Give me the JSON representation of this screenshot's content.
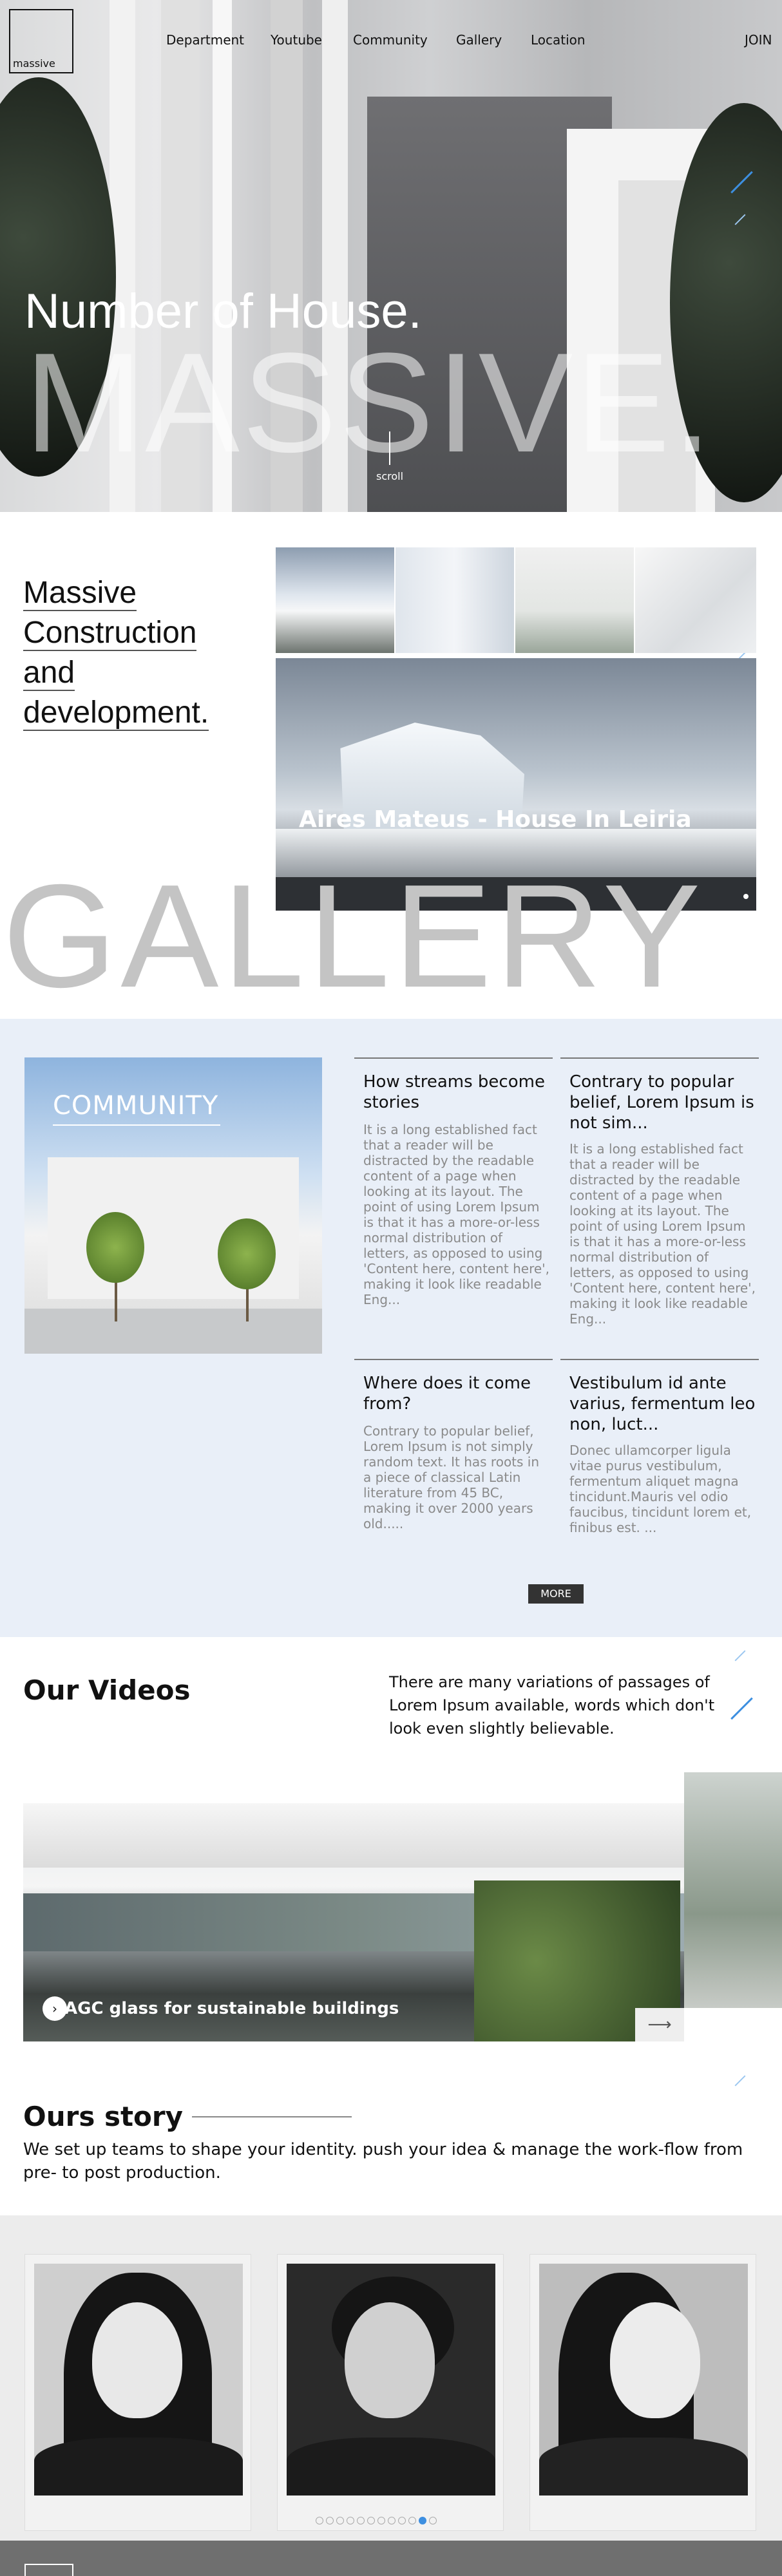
{
  "header": {
    "logo_text": "massive",
    "nav": [
      "Department",
      "Youtube",
      "Community",
      "Gallery",
      "Location"
    ],
    "join_label": "JOIN"
  },
  "hero": {
    "title": "Number of House.",
    "big_text": "MASSIVE.",
    "scroll_label": "scroll"
  },
  "intro": {
    "title_lines": [
      "Massive",
      "Construction",
      "and",
      "development."
    ],
    "feature_caption": "Aires Mateus - House In Leiria",
    "gallery_word": "GALLERY"
  },
  "community": {
    "image_label": "COMMUNITY",
    "cards": [
      {
        "title": "How streams become stories",
        "text": "It is a long established fact that a reader will be distracted by the readable content of a page when looking at its layout. The point of using Lorem Ipsum is that it has a more-or-less normal distribution of letters, as opposed to using 'Content here, content here', making it look like readable Eng..."
      },
      {
        "title": "Contrary to popular belief, Lorem Ipsum is not sim...",
        "text": "It is a long established fact that a reader will be distracted by the readable content of a page when looking at its layout. The point of using Lorem Ipsum is that it has a more-or-less normal distribution of letters, as opposed to using 'Content here, content here', making it look like readable Eng..."
      },
      {
        "title": "Where does it come from?",
        "text": "Contrary to popular belief, Lorem Ipsum is not simply random text. It has roots in a piece of classical Latin literature from 45 BC, making it over 2000 years old....."
      },
      {
        "title": "Vestibulum id ante varius, fermentum leo non, luct...",
        "text": "Donec ullamcorper ligula vitae purus vestibulum, fermentum aliquet magna tincidunt.Mauris vel odio faucibus, tincidunt lorem et, finibus est. ..."
      }
    ],
    "more_label": "MORE"
  },
  "videos": {
    "title": "Our Videos",
    "description": "There are many variations of passages of Lorem Ipsum available, words which don't look even slightly believable.",
    "caption": "AGC glass for sustainable buildings",
    "play_icon": "›",
    "next_arrow": "⟶"
  },
  "story": {
    "title": "Ours story",
    "description": "We set up teams to shape your identity. push your idea & manage the work-flow from pre- to post production.",
    "pager_count": 12,
    "active_page": 10
  },
  "colors": {
    "accent_stroke": "#3d8fe0",
    "community_bg": "#e9eff8",
    "footer_bg": "#6f6f6f"
  }
}
